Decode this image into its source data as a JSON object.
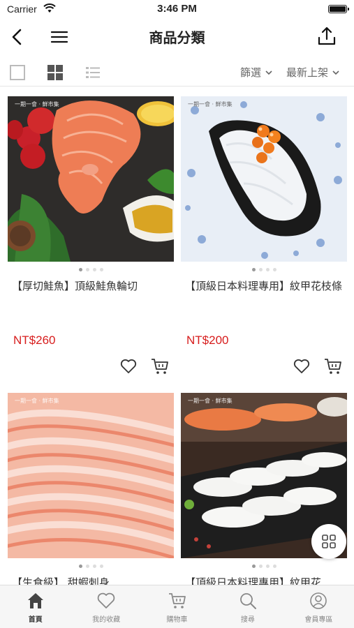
{
  "status_bar": {
    "carrier": "Carrier",
    "time": "3:46 PM"
  },
  "header": {
    "title": "商品分類"
  },
  "toolbar": {
    "filter_label": "篩選",
    "sort_label": "最新上架"
  },
  "products": [
    {
      "name": "【厚切鮭魚】頂級鮭魚輪切",
      "price": "NT$260",
      "brand": "一期一會 · 鮮市集",
      "image": "salmon-steak-photo"
    },
    {
      "name": "【頂級日本料理專用】紋甲花枝條",
      "price": "NT$200",
      "brand": "一期一會 · 鮮市集",
      "image": "squid-roe-sushi-photo"
    },
    {
      "name": "【生食級】 甜蝦刺身",
      "price": "",
      "brand": "一期一會 · 鮮市集",
      "image": "sweet-shrimp-photo"
    },
    {
      "name": "【頂級日本料理專用】紋甲花",
      "price": "",
      "brand": "一期一會 · 鮮市集",
      "image": "squid-nigiri-photo"
    }
  ],
  "tabs": [
    {
      "label": "首頁",
      "icon": "home-icon"
    },
    {
      "label": "我的收藏",
      "icon": "heart-icon"
    },
    {
      "label": "購物車",
      "icon": "cart-icon"
    },
    {
      "label": "搜尋",
      "icon": "search-icon"
    },
    {
      "label": "會員專區",
      "icon": "user-icon"
    }
  ],
  "colors": {
    "price": "#d71c1c",
    "tab_active": "#333333",
    "tab_inactive": "#888888"
  }
}
